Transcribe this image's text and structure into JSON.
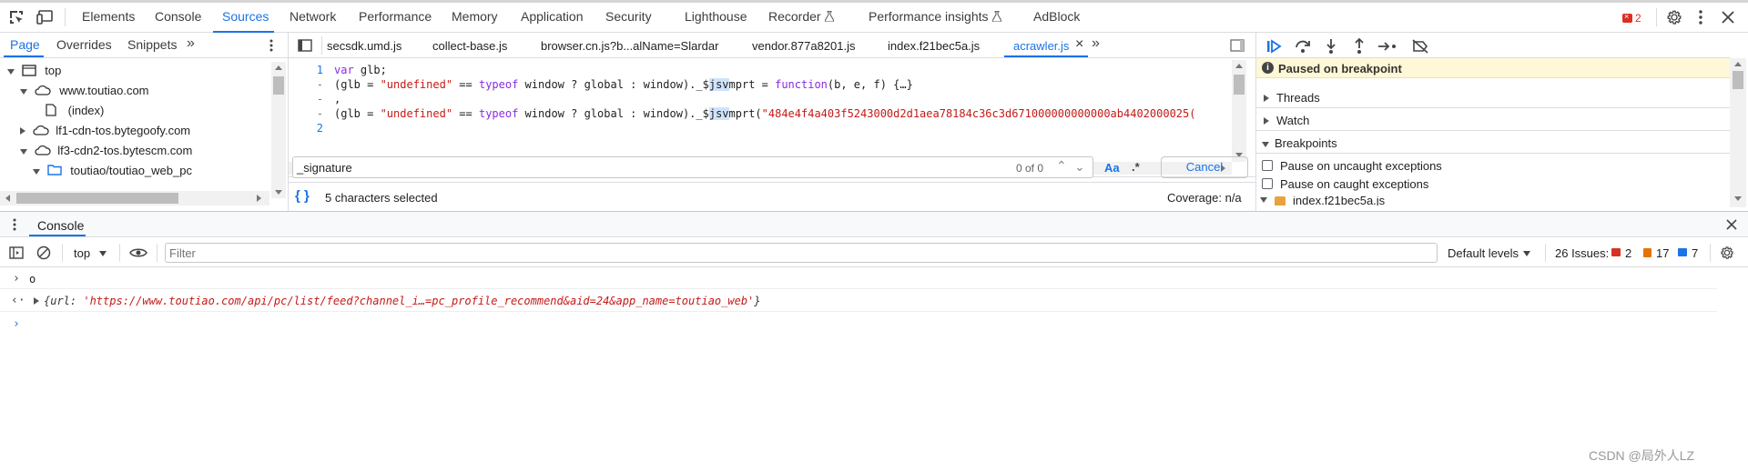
{
  "main_tabs": [
    "Elements",
    "Console",
    "Sources",
    "Network",
    "Performance",
    "Memory",
    "Application",
    "Security",
    "Lighthouse",
    "Recorder",
    "Performance insights",
    "AdBlock"
  ],
  "error_badge": "2",
  "nav_tabs": [
    "Page",
    "Overrides",
    "Snippets"
  ],
  "file_tree": [
    {
      "label": "top"
    },
    {
      "label": "www.toutiao.com"
    },
    {
      "label": "(index)"
    },
    {
      "label": "lf1-cdn-tos.bytegoofy.com"
    },
    {
      "label": "lf3-cdn2-tos.bytescm.com"
    },
    {
      "label": "toutiao/toutiao_web_pc"
    }
  ],
  "editor_tabs": [
    "secsdk.umd.js",
    "collect-base.js",
    "browser.cn.js?b...alName=Slardar",
    "vendor.877a8201.js",
    "index.f21bec5a.js",
    "acrawler.js"
  ],
  "code": {
    "line_numbers": [
      "1",
      "-",
      "-",
      "-",
      "2"
    ],
    "line1": {
      "kw": "var",
      "rest": " glb;"
    },
    "line2": {
      "a": "(glb = ",
      "s1": "\"undefined\"",
      "b": " == ",
      "kw": "typeof",
      "c": " window ? global : window)._$",
      "hl": "jsv",
      "d": "mprt = ",
      "kw2": "function",
      "e": "(b, e, f) {…}"
    },
    "line3": ",",
    "line4": {
      "a": "(glb = ",
      "s1": "\"undefined\"",
      "b": " == ",
      "kw": "typeof",
      "c": " window ? global : window)._$",
      "hl": "jsv",
      "d": "mprt(",
      "s2": "\"484e4f4a403f5243000d2d1aea78184c36c3d671000000000000ab4402000025("
    }
  },
  "search": {
    "value": "_signature",
    "count": "0 of 0",
    "case_label": "Aa",
    "regex_label": ".*",
    "cancel": "Cancel"
  },
  "status": {
    "selection": "5 characters selected",
    "coverage": "Coverage: n/a"
  },
  "debugger": {
    "paused": "Paused on breakpoint",
    "sections": [
      "Threads",
      "Watch",
      "Breakpoints"
    ],
    "options": [
      "Pause on uncaught exceptions",
      "Pause on caught exceptions"
    ],
    "bp_file": "index.f21bec5a.js"
  },
  "drawer": {
    "tab": "Console"
  },
  "console_toolbar": {
    "context": "top",
    "filter_placeholder": "Filter",
    "levels": "Default levels",
    "issues_label": "26 Issues:",
    "issues_err": "2",
    "issues_warn": "17",
    "issues_info": "7"
  },
  "console_lines": {
    "input": "o",
    "output_key": "url: ",
    "output_value": "'https://www.toutiao.com/api/pc/list/feed?channel_i…=pc_profile_recommend&aid=24&app_name=toutiao_web'"
  },
  "watermark": "CSDN @局外人LZ",
  "colors": {
    "accent": "#1a73e8",
    "paused_bg": "#fff8d6",
    "error": "#d93025",
    "warn": "#e37400",
    "info": "#1a73e8",
    "string": "#c41a16",
    "keyword": "#8a2be2"
  }
}
